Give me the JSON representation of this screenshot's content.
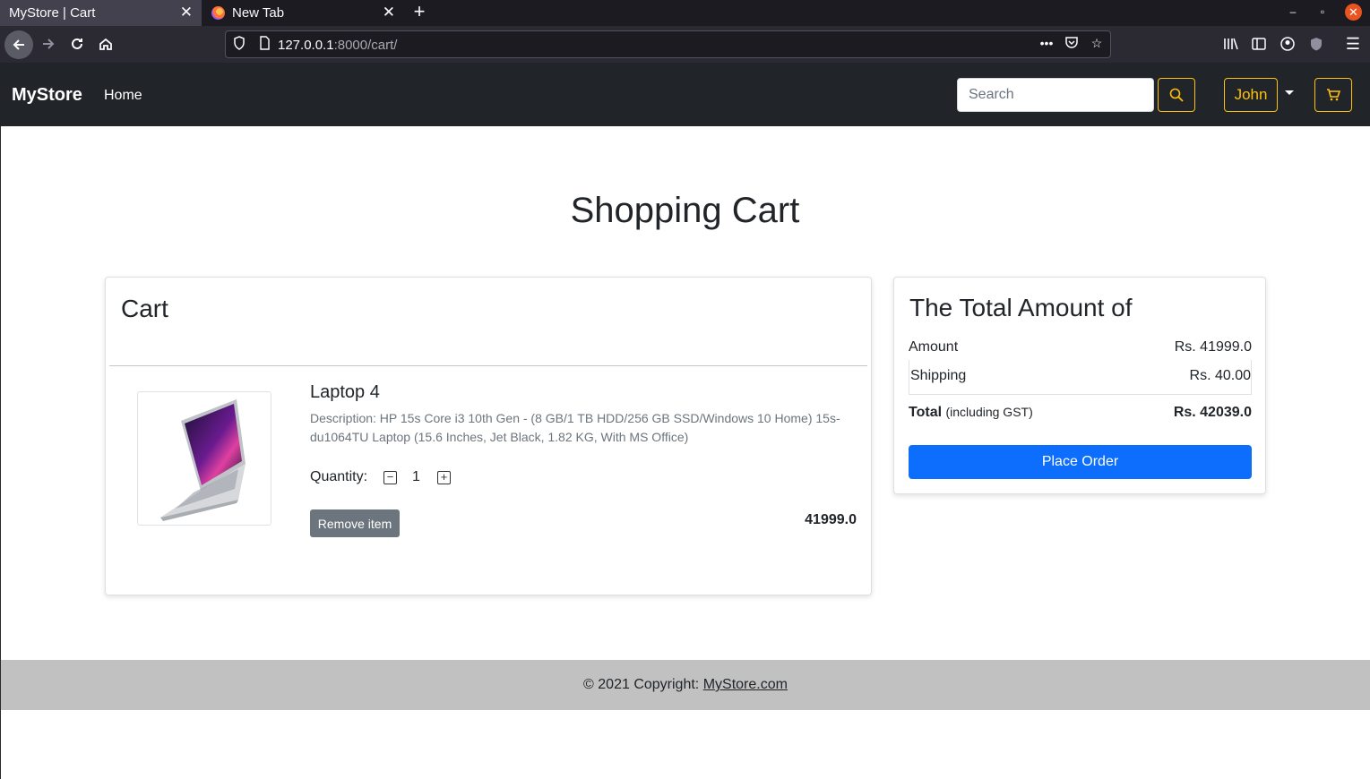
{
  "browser": {
    "tabs": [
      {
        "title": "MyStore | Cart",
        "active": true
      },
      {
        "title": "New Tab",
        "active": false
      }
    ],
    "url_host": "127.0.0.1",
    "url_path": ":8000/cart/"
  },
  "site": {
    "brand": "MyStore",
    "nav_home": "Home",
    "search_placeholder": "Search",
    "user_name": "John",
    "accent_color": "#ffc107"
  },
  "page": {
    "title": "Shopping Cart"
  },
  "cart": {
    "heading": "Cart",
    "item": {
      "name": "Laptop 4",
      "description": "Description: HP 15s Core i3 10th Gen - (8 GB/1 TB HDD/256 GB SSD/Windows 10 Home) 15s-du1064TU Laptop (15.6 Inches, Jet Black, 1.82 KG, With MS Office)",
      "quantity_label": "Quantity:",
      "quantity": "1",
      "remove_label": "Remove item",
      "price": "41999.0"
    }
  },
  "summary": {
    "heading": "The Total Amount of",
    "amount_label": "Amount",
    "amount_value": "Rs. 41999.0",
    "shipping_label": "Shipping",
    "shipping_value": "Rs. 40.00",
    "total_label": "Total",
    "total_sub": "(including GST)",
    "total_value": "Rs. 42039.0",
    "place_order_label": "Place Order",
    "button_color": "#0d6efd"
  },
  "footer": {
    "text": "© 2021 Copyright:",
    "link_text": "MyStore.com"
  }
}
